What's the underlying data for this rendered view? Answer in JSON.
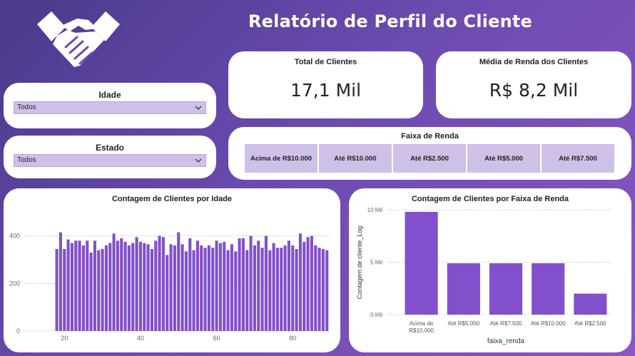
{
  "header": {
    "title": "Relatório de Perfil do Cliente",
    "logo_icon": "handshake-icon"
  },
  "filters": {
    "idade": {
      "label": "Idade",
      "value": "Todos"
    },
    "estado": {
      "label": "Estado",
      "value": "Todos"
    }
  },
  "kpis": {
    "total_clientes": {
      "label": "Total de Clientes",
      "value": "17,1 Mil"
    },
    "media_renda": {
      "label": "Média de Renda dos Clientes",
      "value": "R$ 8,2 Mil"
    }
  },
  "faixa_renda": {
    "title": "Faixa de Renda",
    "options": [
      "Acima de R$10.000",
      "Até R$10.000",
      "Até R$2.500",
      "Até R$5.000",
      "Até R$7.500"
    ]
  },
  "colors": {
    "accent": "#7d4fc9",
    "selection": "#cfc0e8",
    "bar": "#8250cc"
  },
  "chart_data": [
    {
      "type": "bar",
      "title": "Contagem de Clientes por Idade",
      "xlabel": "",
      "ylabel": "",
      "x": [
        18,
        19,
        20,
        21,
        22,
        23,
        24,
        25,
        26,
        27,
        28,
        29,
        30,
        31,
        32,
        33,
        34,
        35,
        36,
        37,
        38,
        39,
        40,
        41,
        42,
        43,
        44,
        45,
        46,
        47,
        48,
        49,
        50,
        51,
        52,
        53,
        54,
        55,
        56,
        57,
        58,
        59,
        60,
        61,
        62,
        63,
        64,
        65,
        66,
        67,
        68,
        69,
        70,
        71,
        72,
        73,
        74,
        75,
        76,
        77,
        78,
        79,
        80,
        81,
        82,
        83,
        84,
        85,
        86,
        87,
        88,
        89
      ],
      "values": [
        345,
        415,
        345,
        385,
        370,
        380,
        380,
        360,
        380,
        330,
        380,
        340,
        345,
        360,
        370,
        410,
        380,
        390,
        375,
        360,
        370,
        395,
        375,
        370,
        365,
        345,
        380,
        400,
        395,
        320,
        365,
        360,
        415,
        365,
        335,
        390,
        340,
        380,
        360,
        350,
        360,
        350,
        380,
        370,
        375,
        340,
        365,
        335,
        390,
        390,
        340,
        400,
        360,
        380,
        350,
        400,
        340,
        370,
        350,
        350,
        360,
        380,
        360,
        345,
        410,
        375,
        395,
        400,
        360,
        350,
        345,
        340
      ],
      "xticks": [
        "20",
        "40",
        "60",
        "80"
      ],
      "yticks": [
        "0",
        "200",
        "400"
      ],
      "ylim": [
        0,
        480
      ],
      "grid": true
    },
    {
      "type": "bar",
      "title": "Contagem de Clientes por Faixa de Renda",
      "xlabel": "faixa_renda",
      "ylabel": "Contagem de cliente_Log",
      "categories": [
        [
          "Acima de",
          "R$10.000"
        ],
        [
          "Até R$5.000"
        ],
        [
          "Até R$7.500"
        ],
        [
          "Até R$10.000"
        ],
        [
          "Até R$2.500"
        ]
      ],
      "values": [
        9800,
        4900,
        4900,
        4900,
        2000
      ],
      "yticks": [
        "0 Mil",
        "5 Mil",
        "10 Mil"
      ],
      "ylim": [
        0,
        10000
      ],
      "grid": true
    }
  ]
}
